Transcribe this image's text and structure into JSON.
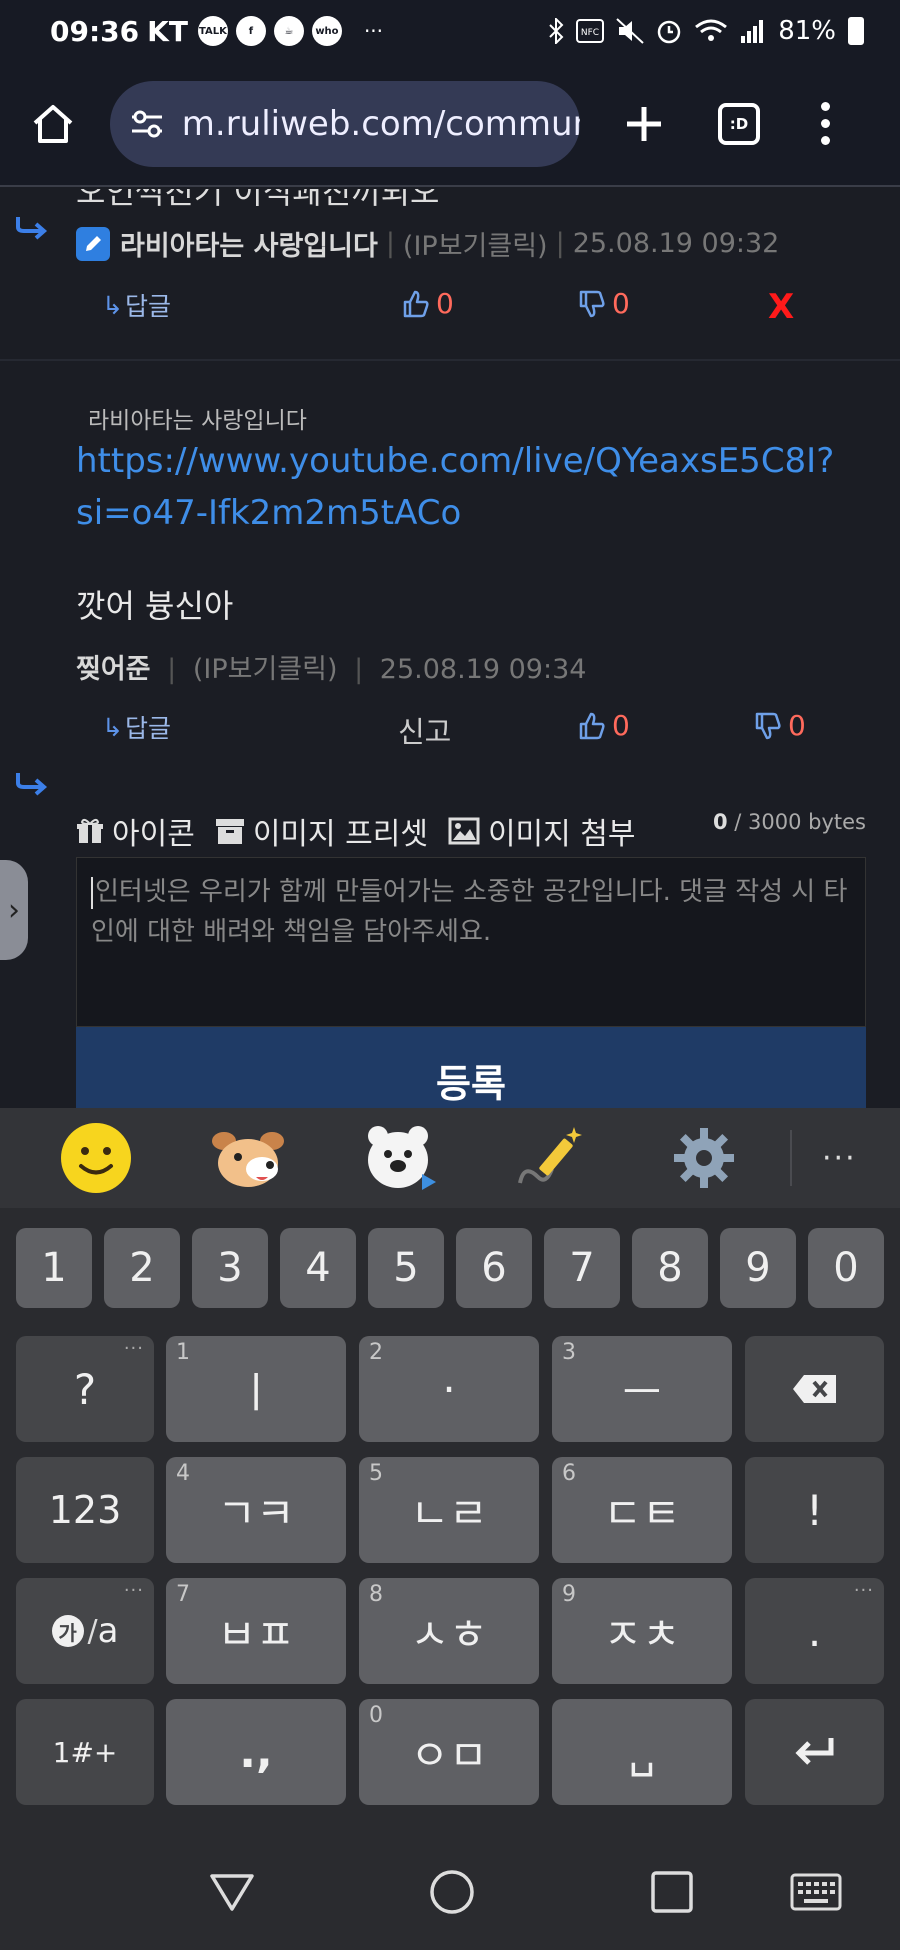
{
  "status_bar": {
    "time": "09:36",
    "carrier": "KT",
    "app_icons": [
      "TALK",
      "f",
      "☕",
      "who"
    ],
    "battery": "81%"
  },
  "address_bar": {
    "url": "m.ruliweb.com/communi",
    "tabs_label": ":D"
  },
  "comment1": {
    "cutoff_text": "오인씩진기 이식쾌진끼되오",
    "author": "라비아타는 사랑입니다",
    "ip_label": "(IP보기클릭)",
    "timestamp": "25.08.19 09:32",
    "reply_label": "답글",
    "likes": "0",
    "dislikes": "0",
    "delete_label": "X"
  },
  "comment2": {
    "mention": "라비아타는 사랑입니다",
    "link": "https://www.youtube.com/live/QYeaxsE5C8I?si=o47-Ifk2m2m5tACo",
    "body": "깟어 븅신아",
    "author": "찢어준",
    "ip_label": "(IP보기클릭)",
    "timestamp": "25.08.19 09:34",
    "reply_label": "답글",
    "report_label": "신고",
    "likes": "0",
    "dislikes": "0"
  },
  "comment_form": {
    "icon_label": "아이콘",
    "preset_label": "이미지 프리셋",
    "attach_label": "이미지 첨부",
    "bytes_count": "0",
    "bytes_max": "/ 3000 bytes",
    "placeholder": "인터넷은 우리가 함께 만들어가는 소중한 공간입니다. 댓글 작성 시 타인에 대한 배려와 책임을 담아주세요.",
    "submit_label": "등록"
  },
  "keyboard": {
    "emoji_toolbar": [
      "smiley-icon",
      "dog-sticker-icon",
      "bear-sticker-icon",
      "magic-pen-icon",
      "settings-icon"
    ],
    "number_row": [
      "1",
      "2",
      "3",
      "4",
      "5",
      "6",
      "7",
      "8",
      "9",
      "0"
    ],
    "row1": {
      "punct": "?",
      "k1": "ㅣ",
      "k1_hint": "1",
      "k2": "·",
      "k2_hint": "2",
      "k3": "ㅡ",
      "k3_hint": "3"
    },
    "row2": {
      "mode": "123",
      "k1": "ㄱㅋ",
      "k1_hint": "4",
      "k2": "ㄴㄹ",
      "k2_hint": "5",
      "k3": "ㄷㅌ",
      "k3_hint": "6",
      "punct": "!"
    },
    "row3": {
      "lang_main": "가",
      "lang_alt": "a",
      "k1": "ㅂㅍ",
      "k1_hint": "7",
      "k2": "ㅅㅎ",
      "k2_hint": "8",
      "k3": "ㅈㅊ",
      "k3_hint": "9",
      "punct": "."
    },
    "row4": {
      "symbols": "1#+",
      "k1": ".,",
      "k2": "ㅇㅁ",
      "k2_hint": "0",
      "k3": "␣"
    },
    "more_dots": "···"
  }
}
